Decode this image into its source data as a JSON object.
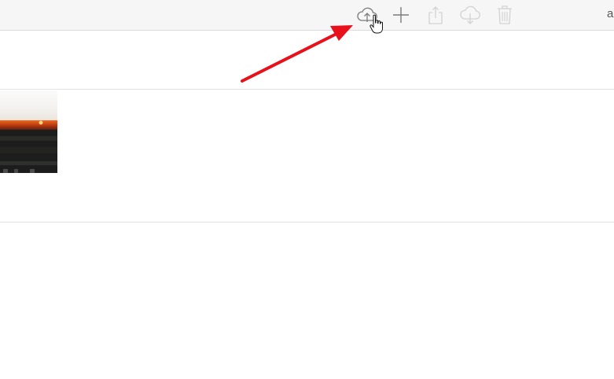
{
  "toolbar": {
    "buttons": [
      {
        "name": "upload",
        "icon": "cloud-upload-icon",
        "enabled": true
      },
      {
        "name": "new-folder",
        "icon": "plus-icon",
        "enabled": true
      },
      {
        "name": "share",
        "icon": "share-icon",
        "enabled": false
      },
      {
        "name": "download",
        "icon": "cloud-download-icon",
        "enabled": false
      },
      {
        "name": "delete",
        "icon": "trash-icon",
        "enabled": false
      }
    ],
    "account_label": "a"
  },
  "colors": {
    "toolbar_bg": "#f6f6f6",
    "icon_active": "#7a7a7a",
    "icon_disabled": "#d2d2d2",
    "annotation_arrow": "#e8101a"
  },
  "content": {
    "items": [
      {
        "type": "photo",
        "icon": "sunset-photo-thumbnail"
      }
    ]
  }
}
